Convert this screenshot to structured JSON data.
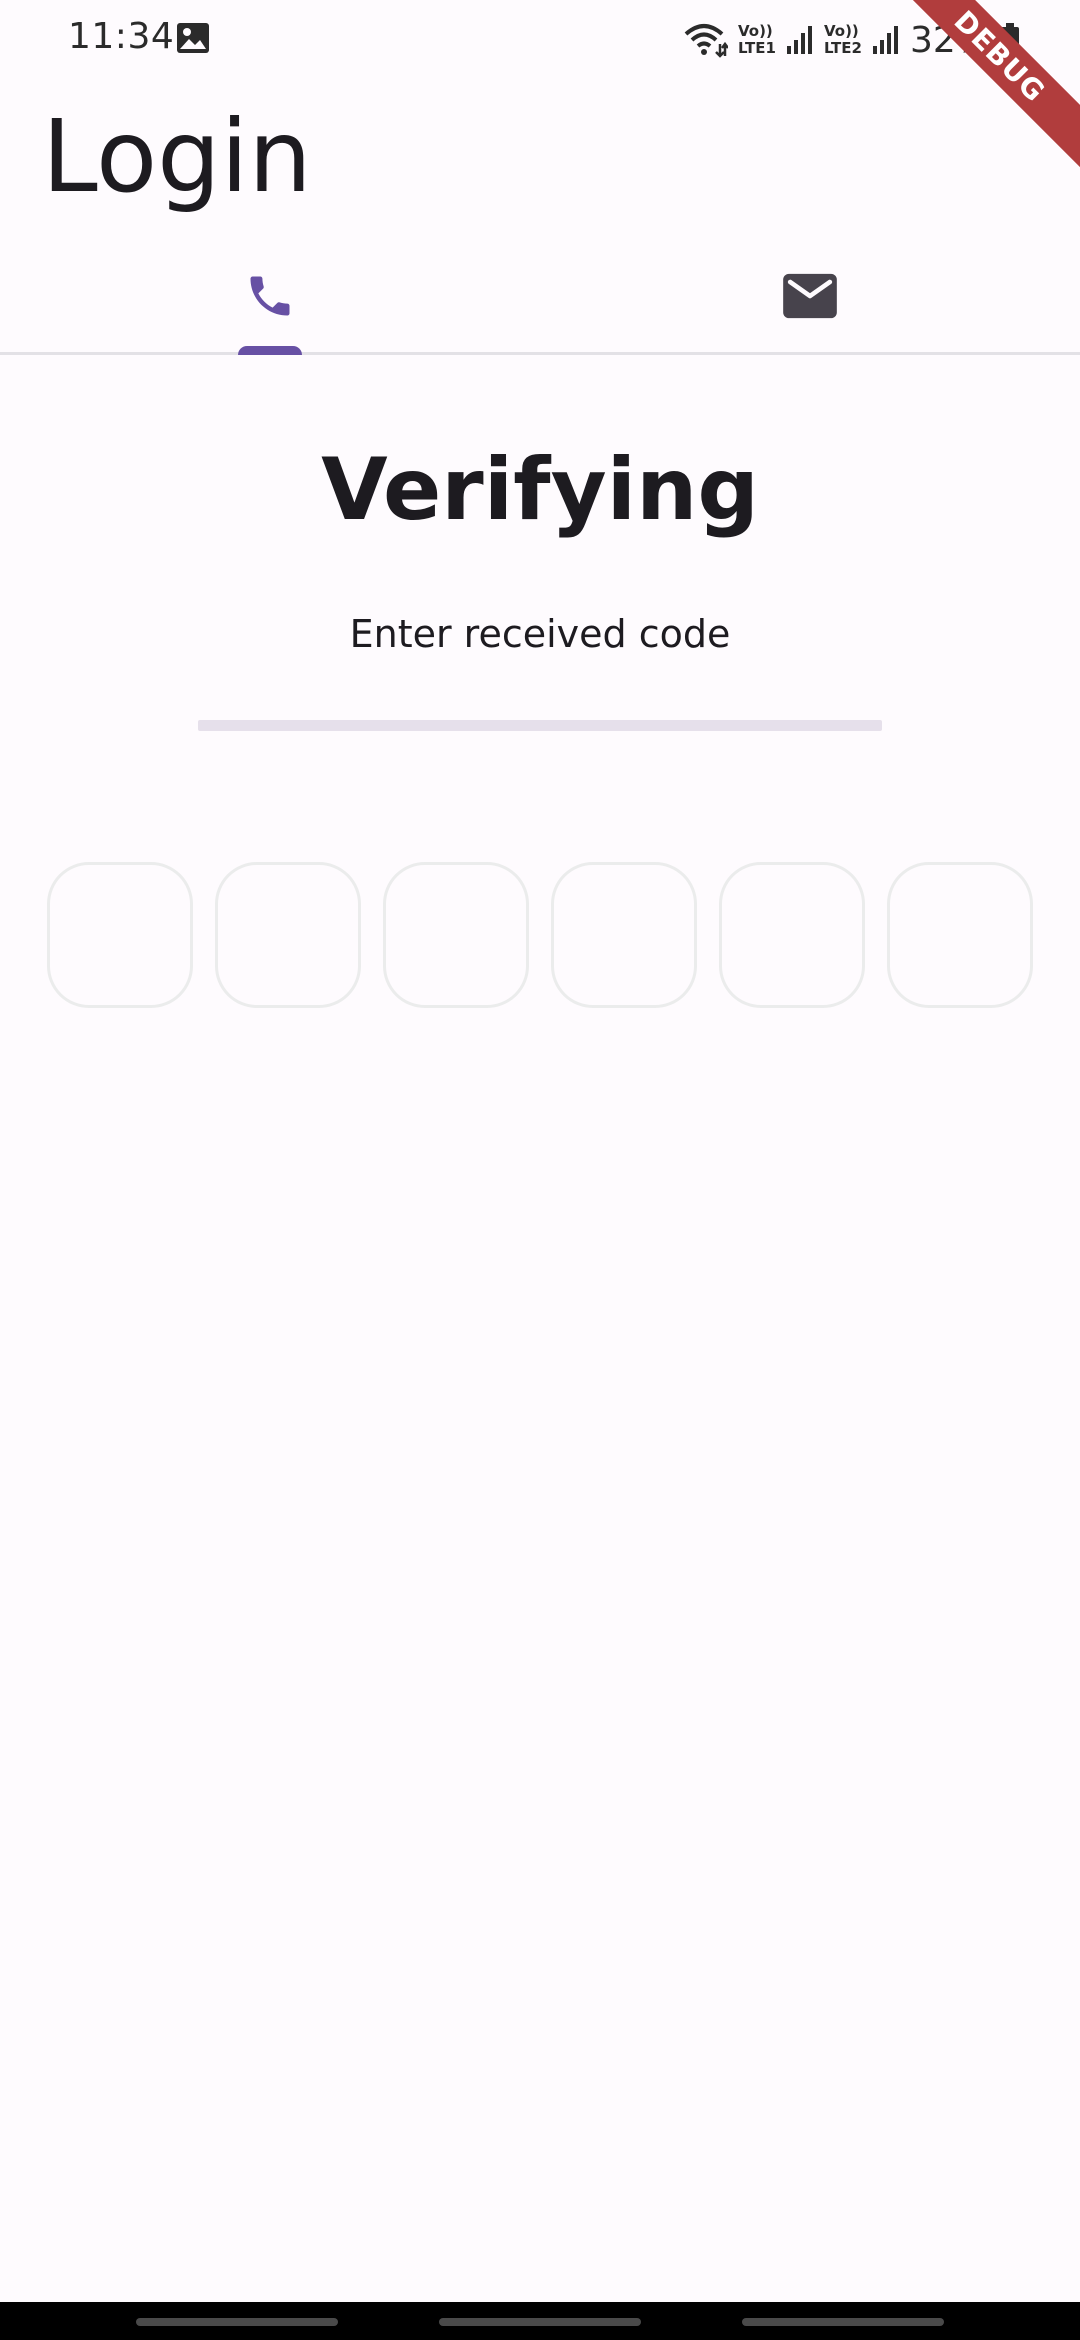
{
  "status_bar": {
    "time": "11:34",
    "sim1_label_top": "Vo))",
    "sim1_label_bottom": "LTE1",
    "sim2_label_top": "Vo))",
    "sim2_label_bottom": "LTE2",
    "battery": "32%"
  },
  "debug_banner": "DEBUG",
  "header": {
    "title": "Login"
  },
  "tabs": [
    {
      "name": "phone",
      "icon": "phone-icon",
      "selected": true
    },
    {
      "name": "email",
      "icon": "email-icon",
      "selected": false
    }
  ],
  "verification": {
    "title": "Verifying",
    "subtitle": "Enter received code",
    "code_digits": [
      "",
      "",
      "",
      "",
      "",
      ""
    ]
  },
  "colors": {
    "accent": "#6750a4",
    "background": "#fefbfe",
    "text": "#1d1b20",
    "debug": "#b13d3d"
  }
}
